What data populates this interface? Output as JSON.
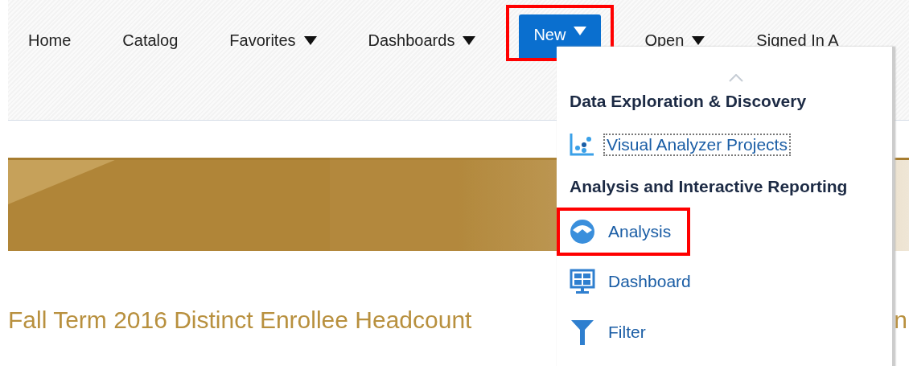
{
  "nav": [
    {
      "label": "Home",
      "dropdown": false,
      "selected": false,
      "highlighted": false
    },
    {
      "label": "Catalog",
      "dropdown": false,
      "selected": false,
      "highlighted": false
    },
    {
      "label": "Favorites",
      "dropdown": true,
      "selected": false,
      "highlighted": false
    },
    {
      "label": "Dashboards",
      "dropdown": true,
      "selected": false,
      "highlighted": false
    },
    {
      "label": "New",
      "dropdown": true,
      "selected": true,
      "highlighted": true
    },
    {
      "label": "Open",
      "dropdown": true,
      "selected": false,
      "highlighted": false
    },
    {
      "label": "Signed In A",
      "dropdown": false,
      "selected": false,
      "highlighted": false
    }
  ],
  "page": {
    "title": "Fall Term 2016 Distinct Enrollee Headcount",
    "title_fragment": "n"
  },
  "menu": {
    "sections": [
      {
        "heading": "Data Exploration & Discovery",
        "items": [
          {
            "label": "Visual Analyzer Projects",
            "kind": "scatter",
            "focused": true,
            "highlighted": false
          }
        ]
      },
      {
        "heading": "Analysis and Interactive Reporting",
        "items": [
          {
            "label": "Analysis",
            "kind": "analysis",
            "focused": false,
            "highlighted": true
          },
          {
            "label": "Dashboard",
            "kind": "dashboard",
            "focused": false,
            "highlighted": false
          },
          {
            "label": "Filter",
            "kind": "filter",
            "focused": false,
            "highlighted": false
          }
        ]
      }
    ]
  }
}
